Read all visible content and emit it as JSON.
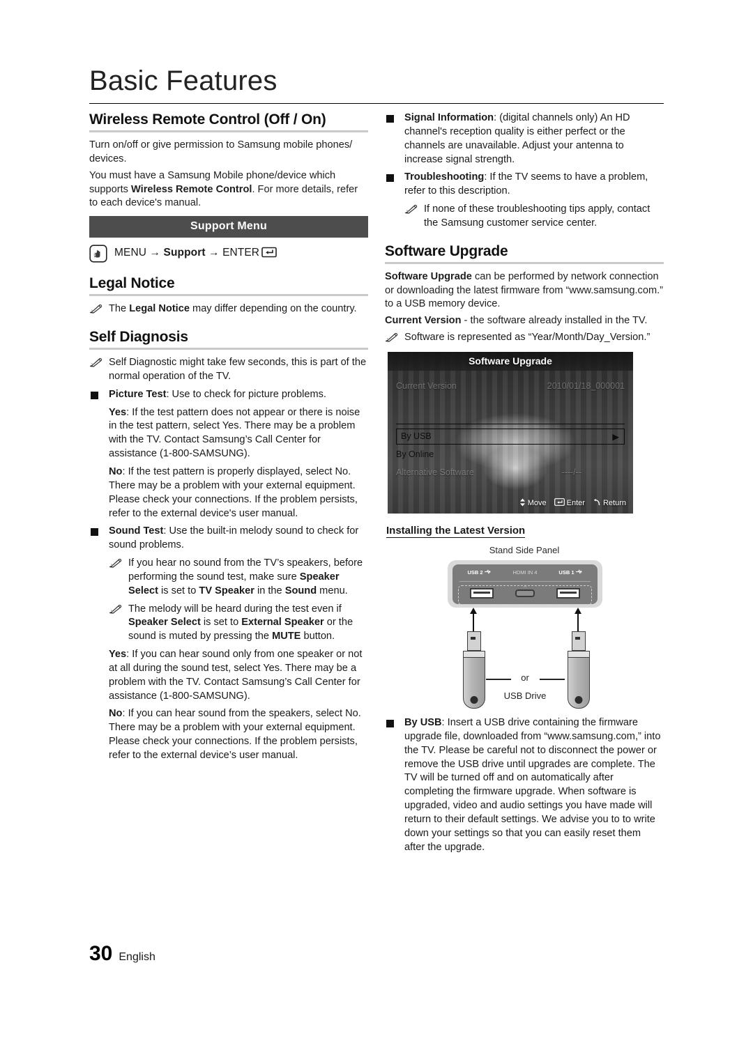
{
  "page": {
    "chapter_title": "Basic Features",
    "page_number": "30",
    "language": "English"
  },
  "left_column": {
    "wireless": {
      "heading": "Wireless Remote Control (Off / On)",
      "para1": "Turn on/off or give permission to Samsung mobile phones/ devices.",
      "para2_a": "You must have a Samsung Mobile phone/device which supports ",
      "para2_b": "Wireless Remote Control",
      "para2_c": ". For more details, refer to each device's manual."
    },
    "support_menu": {
      "banner": "Support Menu",
      "path_menu": "MENU",
      "path_arrow": "→",
      "path_support": "Support",
      "path_enter": "ENTER",
      "press_icon": "press-finger-icon",
      "enter_icon": "enter-key-icon"
    },
    "legal_notice": {
      "heading": "Legal Notice",
      "note_a": "The ",
      "note_b": "Legal Notice",
      "note_c": " may differ depending on the country."
    },
    "self_diagnosis": {
      "heading": "Self Diagnosis",
      "note1": "Self Diagnostic might take few seconds, this is part of the normal operation of the TV.",
      "picture_test_label": "Picture Test",
      "picture_test_text": ": Use to check for picture problems.",
      "picture_yes_label": "Yes",
      "picture_yes_text": ": If the test pattern does not appear or there is noise in the test pattern, select Yes. There may be a problem with the TV. Contact Samsung’s Call Center for assistance (1-800-SAMSUNG).",
      "picture_no_label": "No",
      "picture_no_text": ": If the test pattern is properly displayed, select No. There may be a problem with your external equipment. Please check your connections. If the problem persists, refer to the external device's user manual.",
      "sound_test_label": "Sound Test",
      "sound_test_text": ": Use the built-in melody sound to check for sound problems.",
      "sound_note1_a": "If you hear no sound from the TV’s speakers, before performing the sound test, make sure ",
      "sound_note1_b": "Speaker Select",
      "sound_note1_c": " is set to ",
      "sound_note1_d": "TV Speaker",
      "sound_note1_e": " in the ",
      "sound_note1_f": "Sound",
      "sound_note1_g": " menu.",
      "sound_note2_a": "The melody will be heard during the test even if ",
      "sound_note2_b": "Speaker Select",
      "sound_note2_c": " is set to ",
      "sound_note2_d": "External Speaker",
      "sound_note2_e": " or the sound is muted by pressing the ",
      "sound_note2_f": "MUTE",
      "sound_note2_g": " button.",
      "sound_yes_label": "Yes",
      "sound_yes_text": ": If you can hear sound only from one speaker or not at all during the sound test, select Yes. There may be a problem with the TV. Contact Samsung’s Call Center for assistance (1-800-SAMSUNG).",
      "sound_no_label": "No",
      "sound_no_text": ": If you can hear sound from the speakers, select No. There may be a problem with your external equipment. Please check your connections. If the problem persists, refer to the external device’s user manual."
    }
  },
  "right_column": {
    "signal_info_label": "Signal Information",
    "signal_info_text": ": (digital channels only) An HD channel's reception quality is either perfect or the channels are unavailable. Adjust your antenna to increase signal strength.",
    "troubleshooting_label": "Troubleshooting",
    "troubleshooting_text": ": If the TV seems to have a problem, refer to this description.",
    "troubleshooting_note": "If none of these troubleshooting tips apply, contact the Samsung customer service center.",
    "software_upgrade": {
      "heading": "Software Upgrade",
      "para1_a": "Software Upgrade",
      "para1_b": " can be performed by network connection or downloading the latest firmware from “www.samsung.com.” to a USB memory device.",
      "para2_a": "Current Version",
      "para2_b": " - the software already installed in the TV.",
      "note1": "Software is represented as “Year/Month/Day_Version.”"
    },
    "tv_screen": {
      "title": "Software Upgrade",
      "current_version_label": "Current Version",
      "current_version_value": "2010/01/18_000001",
      "by_usb": "By USB",
      "by_usb_arrow": "▶",
      "by_online": "By Online",
      "alternative_label": "Alternative Software",
      "alternative_value": "----/--",
      "hint_move": "Move",
      "hint_enter": "Enter",
      "hint_return": "Return",
      "move_icon": "up-down-arrow-icon",
      "enter_icon": "enter-key-icon",
      "return_icon": "return-arrow-icon"
    },
    "installing": {
      "heading": "Installing the Latest Version",
      "stand_side_panel": "Stand Side Panel",
      "usb2_label": "USB 2",
      "hdmi_label": "HDMI IN 4",
      "usb1_label": "USB 1",
      "usb_icon": "usb-trident-icon",
      "or_text": "or",
      "usb_drive_text": "USB Drive"
    },
    "by_usb_label": "By USB",
    "by_usb_text": ": Insert a USB drive containing the firmware upgrade file, downloaded from “www.samsung.com,” into the TV. Please be careful not to disconnect the power or remove the USB drive until upgrades are complete. The TV will be turned off and on automatically after completing the firmware upgrade. When software is upgraded, video and audio settings you have made will return to their default settings. We advise you to to write down your settings so that you can easily reset them after the upgrade."
  },
  "colors": {
    "banner_bg": "#4d4d4d",
    "rule": "#c9c9c9",
    "text": "#1a1a1a"
  }
}
